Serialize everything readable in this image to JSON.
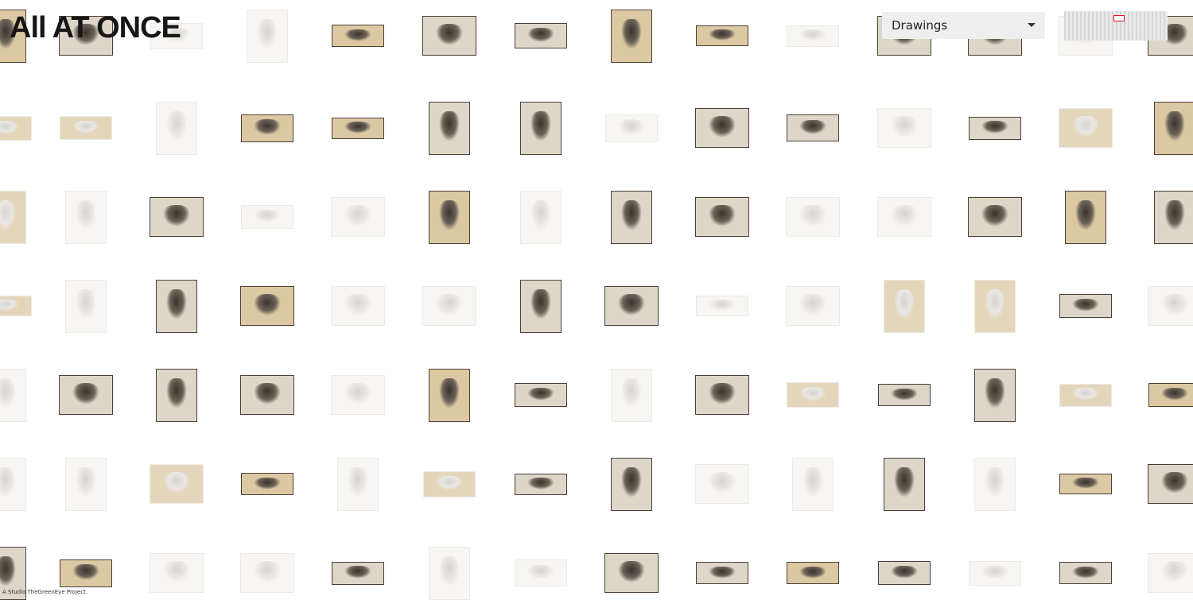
{
  "header": {
    "title": "All AT ONCE"
  },
  "filter": {
    "selected": "Drawings"
  },
  "footer": {
    "credit": "A Studio TheGreenEye Project."
  },
  "colors": {
    "accent": "#e0142c",
    "background": "#ffffff",
    "dropdown_bg": "#efefef"
  }
}
